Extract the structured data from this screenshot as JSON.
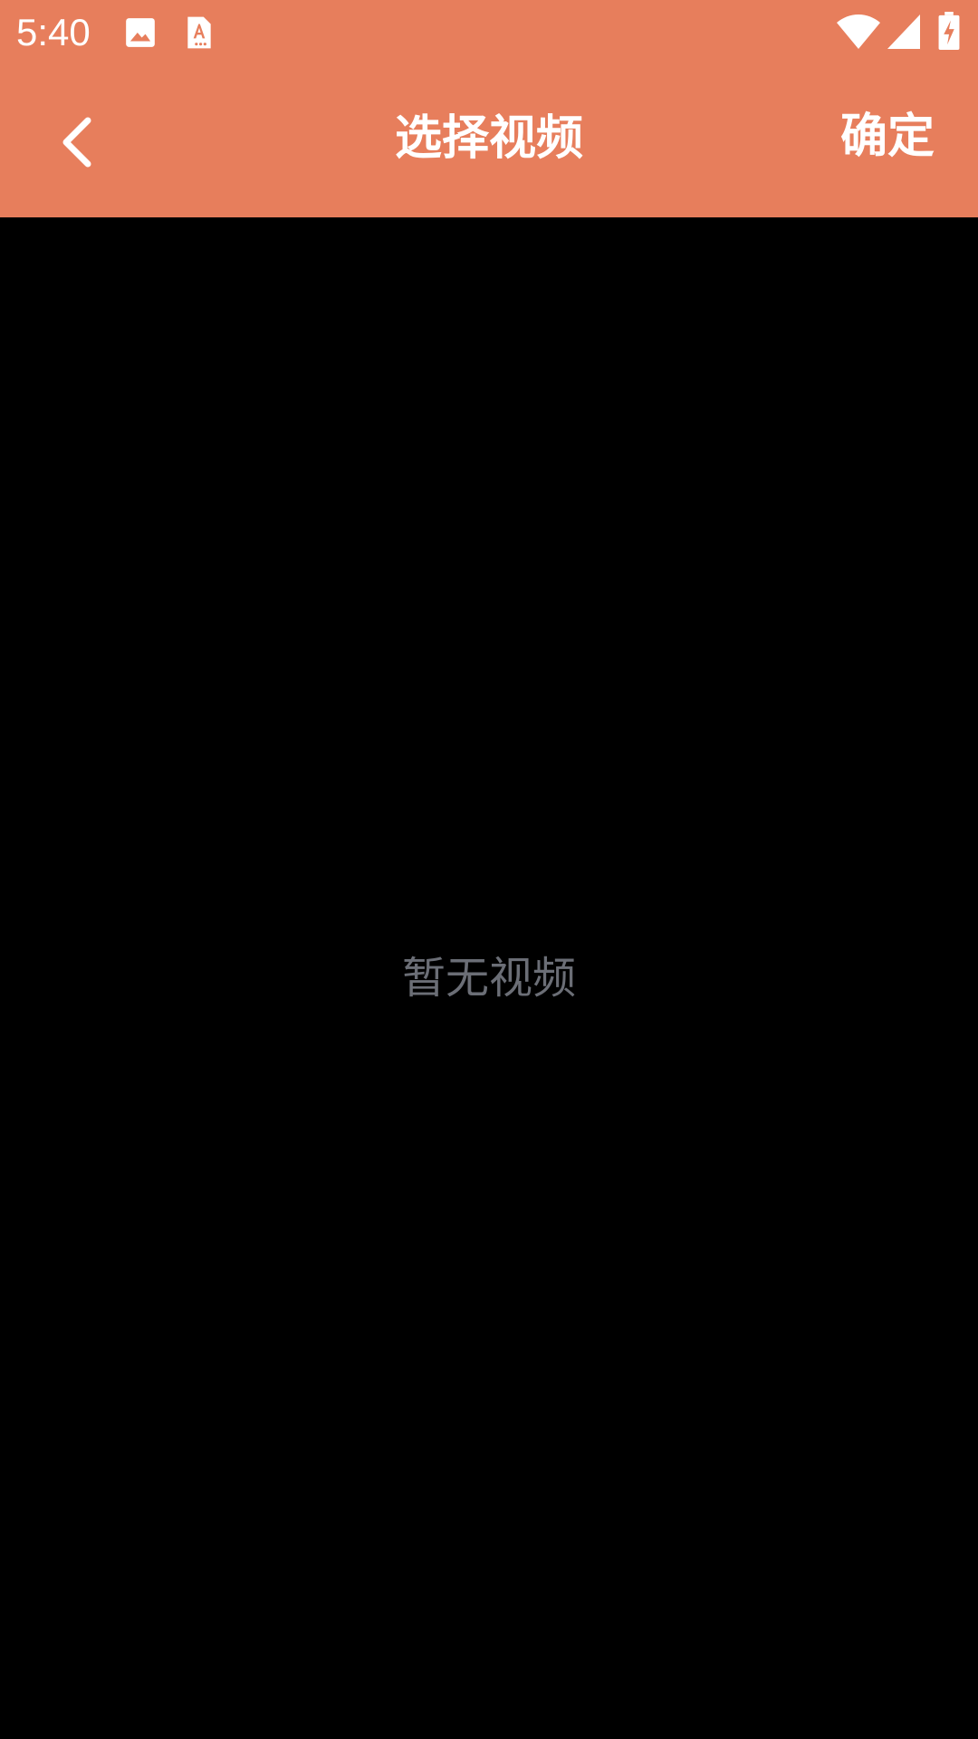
{
  "status_bar": {
    "time": "5:40",
    "icons": [
      "image-icon",
      "font-download-icon",
      "wifi-icon",
      "cell-signal-icon",
      "battery-charging-icon"
    ]
  },
  "app_bar": {
    "title": "选择视频",
    "confirm_label": "确定",
    "back_icon": "chevron-left-icon"
  },
  "content": {
    "empty_message": "暂无视频"
  },
  "colors": {
    "accent": "#E77E5C",
    "background": "#000000",
    "empty_text": "#6B6E76"
  }
}
